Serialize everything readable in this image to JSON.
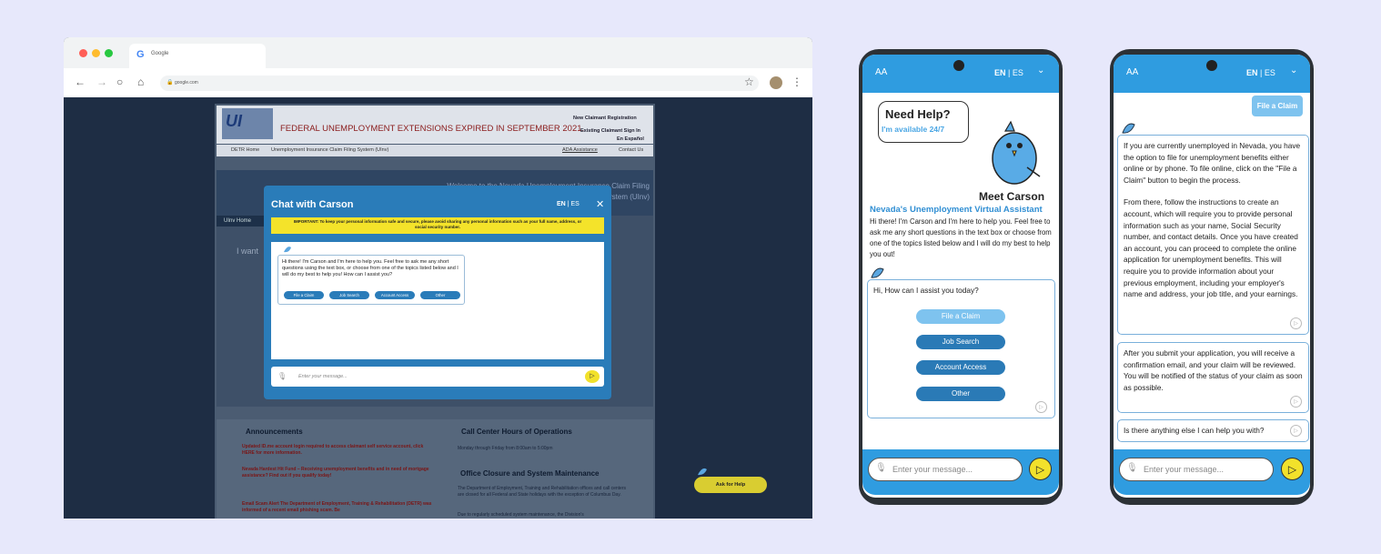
{
  "browser": {
    "tab_title": "Google",
    "url": "google.com"
  },
  "site": {
    "logo_text": "UI",
    "headline": "FEDERAL UNEMPLOYMENT EXTENSIONS EXPIRED IN SEPTEMBER 2021.",
    "header_links": [
      "New Claimant Registration",
      "Existing Claimant Sign In",
      "En Español"
    ],
    "nav": {
      "home": "DETR Home",
      "crumb": "Unemployment Insurance Claim Filing System (UInv)",
      "ada": "ADA Assistance",
      "contact": "Contact Us"
    },
    "banner_text": "Welcome to the Nevada Unemployment Insurance Claim Filing System (UInv)",
    "tab": "UInv Home",
    "i_want": "I want",
    "announcements": {
      "title": "Announcements",
      "items": [
        "Updated ID.me account login required to access claimant self service account, click HERE for more information.",
        "Nevada Hardest Hit Fund – Receiving unemployment benefits and in need of mortgage assistance? Find out if you qualify today!",
        "Email Scam Alert The Department of Employment, Training & Rehabilitation (DETR) was informed of a recent email phishing scam. Be"
      ]
    },
    "call_center": {
      "title": "Call Center Hours of Operations",
      "text": "Monday through Friday from 8:00am to 5:00pm"
    },
    "closure": {
      "title": "Office Closure and System Maintenance",
      "text": "The Department of Employment, Training and Rehabilitation offices and call centers are closed for all Federal and State holidays with the exception of Columbus Day.",
      "text2": "Due to regularly scheduled system maintenance, the Division's"
    },
    "help_button": "Ask for Help"
  },
  "modal": {
    "title": "Chat with Carson",
    "lang_en": "EN",
    "lang_es": "ES",
    "close": "✕",
    "warning": "IMPORTANT: To keep your personal information safe and secure, please avoid sharing any personal information such as your full name, address, or social security number.",
    "greeting": "Hi there! I'm Carson and I'm here to help you.  Feel free to ask me any short questions using the text box, or choose from one of the topics listed below and I will do my best to help you! How can I assist you?",
    "buttons": [
      "File a Claim",
      "Job Search",
      "Account Access",
      "Other"
    ],
    "input_placeholder": "Enter your message..."
  },
  "phone1": {
    "font_toggle": "AA",
    "lang_en": "EN",
    "lang_es": "ES",
    "need_help": "Need Help?",
    "available": "I'm available 24/7",
    "meet": "Meet Carson",
    "subtitle": "Nevada's Unemployment Virtual Assistant",
    "intro": "Hi there! I'm Carson and I'm here to help you.  Feel free to ask me any short questions in the text box or choose from one of the topics listed below and I will do my best to help you out!",
    "question": "Hi, How can I assist you today?",
    "options": [
      "File a Claim",
      "Job Search",
      "Account Access",
      "Other"
    ],
    "input_placeholder": "Enter your message..."
  },
  "phone2": {
    "font_toggle": "AA",
    "lang_en": "EN",
    "lang_es": "ES",
    "user_message": "File a Claim",
    "reply1": "If you are currently unemployed in Nevada, you have the option to file for unemployment benefits either online or by phone. To file online, click on the \"File a Claim\" button to begin the process.",
    "reply2": "From there, follow the instructions to create an account, which will require you to provide personal information such as your name, Social Security number, and contact details. Once you have created an account, you can proceed to complete the online application for unemployment benefits. This will require you to provide information about your previous employment, including your employer's name and address, your job title, and your earnings.",
    "reply3": "After you submit your application, you will receive a confirmation email, and your claim will be reviewed. You will be notified of the status of your claim as soon as possible.",
    "reply4": "Is there anything else I can help you with?",
    "input_placeholder": "Enter your message..."
  }
}
